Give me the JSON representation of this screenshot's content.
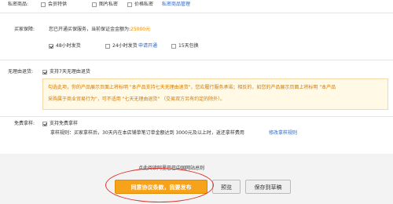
{
  "top_row": {
    "label": "私密商品:",
    "options": [
      {
        "label": "会员特供",
        "checked": false
      },
      {
        "label": "图片私密",
        "checked": false
      },
      {
        "label": "价格私密",
        "checked": false
      }
    ],
    "manage_link": "私密商品管理"
  },
  "buyer_protection": {
    "label": "买家保障:",
    "description_prefix": "您已开通买保服务，当前保证金金额为:",
    "amount": "25000元",
    "options": [
      {
        "label": "48小时发货",
        "checked": true
      },
      {
        "label": "24小时发货",
        "checked": false
      }
    ],
    "apply_link": "申请开通",
    "option_15": {
      "label": "15天包换",
      "checked": false
    }
  },
  "no_reason_return": {
    "label": "无理由退货:",
    "checkbox_label": "支持7天无理由退货",
    "checked": true,
    "notice_line1": "勾选此项，你的产品展示页面上将标明 \"本产品支持七天无理由退货\"，您应履行服务承诺；相反的，如您的产品展示页面上将标明 \"本产品",
    "notice_line2": "采购属于商业贸易行为\"，可不适用 \"七天无理由退货\" （交易双方另有约定的除外）。"
  },
  "free_sample": {
    "label": "免费拿样:",
    "checkbox_label": "支持免费拿样",
    "checked": true,
    "rules_text": "拿样规则：买家拿样后，30天内在本店铺单笔订单金额达到 3000元及以上时，返还拿样费用",
    "rules_link": "修改拿样规则"
  },
  "footer": {
    "agreement_text": "点此阅读阿里巴巴中国网站总则",
    "submit_label": "同意协议条款，我要发布",
    "preview_label": "预览",
    "draft_label": "保存到草稿"
  }
}
